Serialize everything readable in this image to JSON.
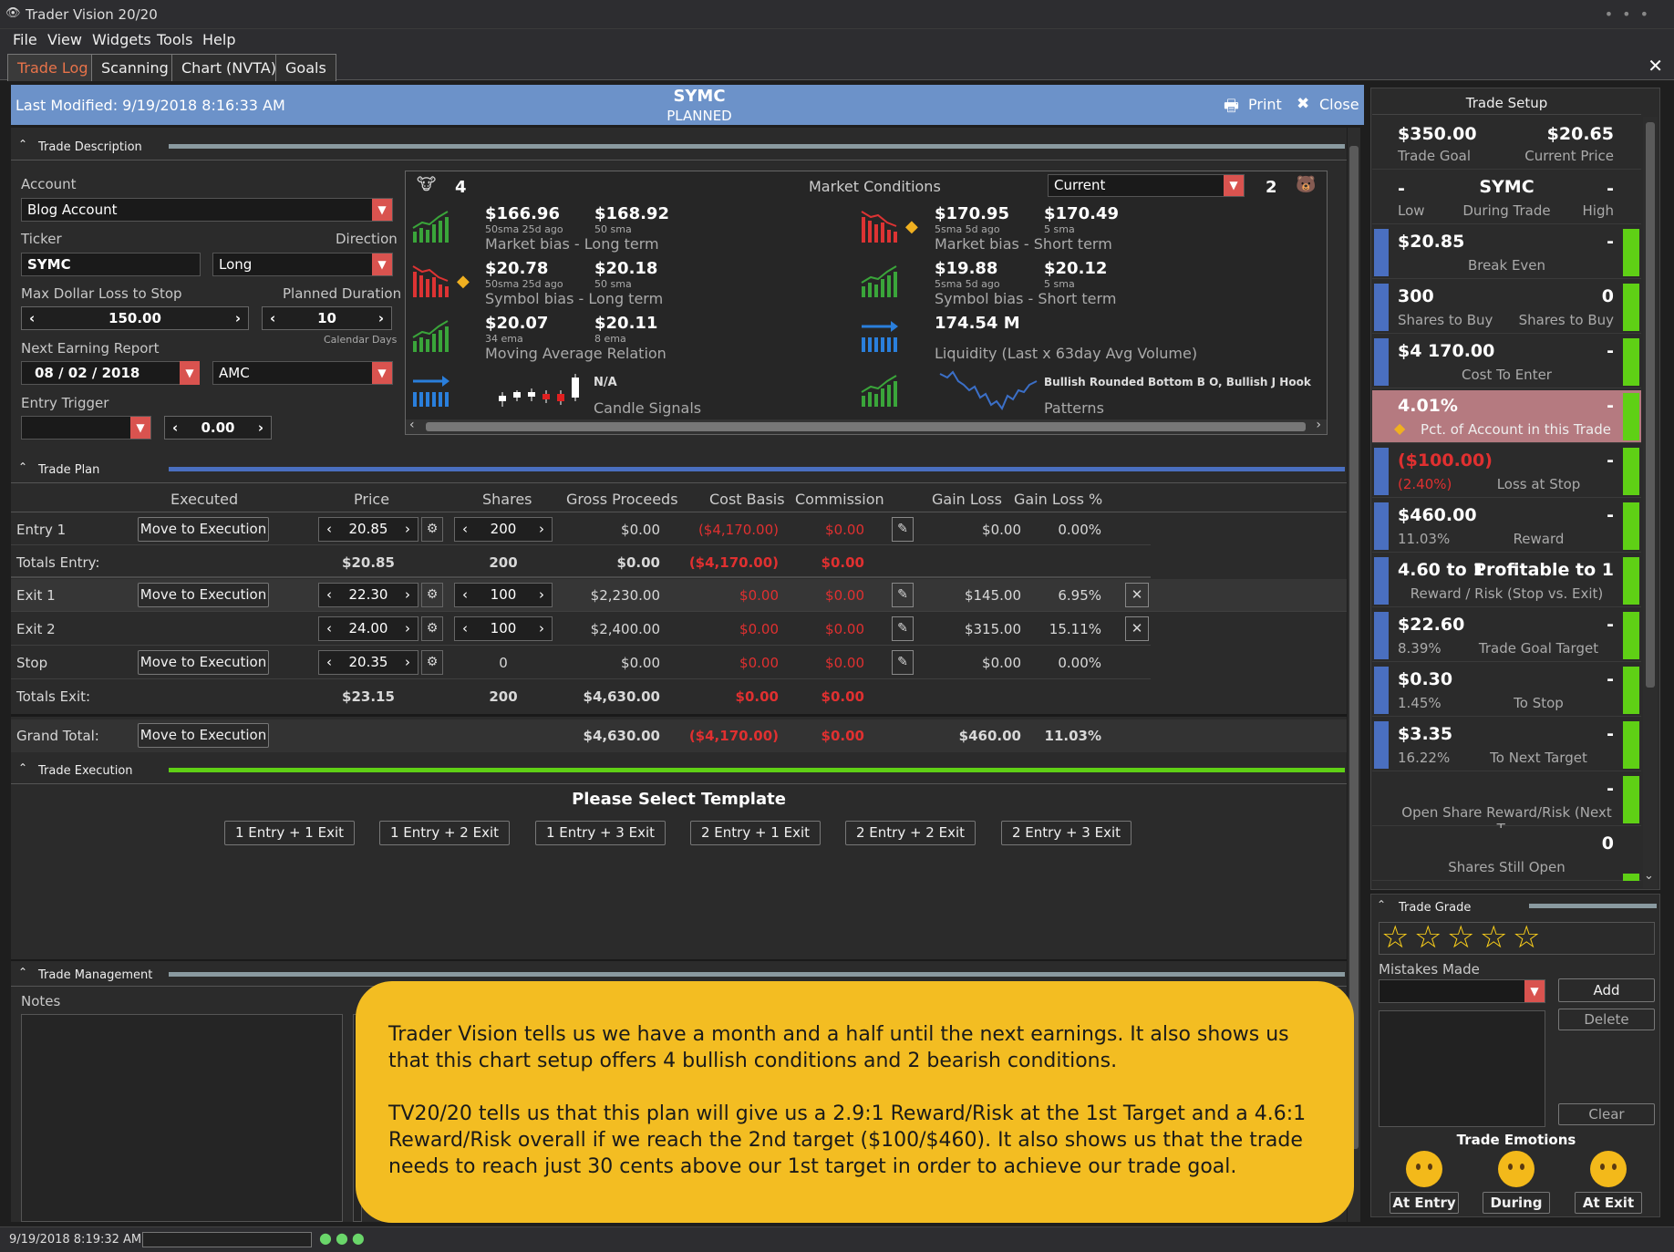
{
  "app": {
    "title": "Trader Vision 20/20"
  },
  "menu": [
    "File",
    "View",
    "Widgets",
    "Tools",
    "Help"
  ],
  "tabs": [
    "Trade Log",
    "Scanning",
    "Chart (NVTA)",
    "Goals"
  ],
  "header": {
    "last_modified": "Last Modified: 9/19/2018 8:16:33 AM",
    "ticker": "SYMC",
    "status": "PLANNED",
    "print": "Print",
    "close": "Close"
  },
  "trade_description": {
    "title": "Trade Description",
    "account_label": "Account",
    "account_value": "Blog Account",
    "ticker_label": "Ticker",
    "ticker_value": "SYMC",
    "direction_label": "Direction",
    "direction_value": "Long",
    "max_loss_label": "Max Dollar Loss to Stop",
    "max_loss_value": "150.00",
    "duration_label": "Planned Duration",
    "duration_value": "10",
    "duration_unit": "Calendar Days",
    "earnings_label": "Next Earning Report",
    "earnings_date": "08 / 02 / 2018",
    "earnings_time": "AMC",
    "entry_trigger_label": "Entry Trigger",
    "entry_trigger_value": "0.00"
  },
  "market_conditions": {
    "title": "Market Conditions",
    "bull_count": "4",
    "bear_count": "2",
    "select_value": "Current",
    "rows": [
      {
        "l1v": "$166.96",
        "l1s": "50sma 25d ago",
        "l2v": "$168.92",
        "l2s": "50 sma",
        "llabel": "Market bias - Long term",
        "r1v": "$170.95",
        "r1s": "5sma 5d ago",
        "r2v": "$170.49",
        "r2s": "5 sma",
        "rlabel": "Market bias - Short term"
      },
      {
        "l1v": "$20.78",
        "l1s": "50sma 25d ago",
        "l2v": "$20.18",
        "l2s": "50 sma",
        "llabel": "Symbol bias - Long term",
        "r1v": "$19.88",
        "r1s": "5sma 5d ago",
        "r2v": "$20.12",
        "r2s": "5 sma",
        "rlabel": "Symbol bias - Short term"
      },
      {
        "l1v": "$20.07",
        "l1s": "34 ema",
        "l2v": "$20.11",
        "l2s": "8 ema",
        "llabel": "Moving Average Relation",
        "r1v": "174.54 M",
        "r1s": "",
        "r2v": "",
        "r2s": "",
        "rlabel": "Liquidity (Last x 63day Avg Volume)"
      },
      {
        "l1v": "N/A",
        "l1s": "",
        "l2v": "",
        "l2s": "",
        "llabel": "Candle Signals",
        "r1v": "Bullish Rounded Bottom B O, Bullish J Hook",
        "r1s": "",
        "r2v": "",
        "r2s": "",
        "rlabel": "Patterns"
      }
    ]
  },
  "trade_plan": {
    "title": "Trade Plan",
    "columns": [
      "Executed",
      "Price",
      "Shares",
      "Gross Proceeds",
      "Cost Basis",
      "Commission",
      "Gain Loss",
      "Gain Loss %"
    ],
    "move_label": "Move to Execution",
    "entry1": {
      "label": "Entry 1",
      "price": "20.85",
      "shares": "200",
      "gross": "$0.00",
      "cost": "($4,170.00)",
      "comm": "$0.00",
      "gain": "$0.00",
      "pct": "0.00%"
    },
    "totals_entry": {
      "label": "Totals Entry:",
      "price": "$20.85",
      "shares": "200",
      "gross": "$0.00",
      "cost": "($4,170.00)",
      "comm": "$0.00"
    },
    "exit1": {
      "label": "Exit 1",
      "price": "22.30",
      "shares": "100",
      "gross": "$2,230.00",
      "cost": "$0.00",
      "comm": "$0.00",
      "gain": "$145.00",
      "pct": "6.95%"
    },
    "exit2": {
      "label": "Exit 2",
      "price": "24.00",
      "shares": "100",
      "gross": "$2,400.00",
      "cost": "$0.00",
      "comm": "$0.00",
      "gain": "$315.00",
      "pct": "15.11%"
    },
    "stop": {
      "label": "Stop",
      "price": "20.35",
      "shares": "0",
      "gross": "$0.00",
      "cost": "$0.00",
      "comm": "$0.00",
      "gain": "$0.00",
      "pct": "0.00%"
    },
    "totals_exit": {
      "label": "Totals Exit:",
      "price": "$23.15",
      "shares": "200",
      "gross": "$4,630.00",
      "cost": "$0.00",
      "comm": "$0.00"
    },
    "grand": {
      "label": "Grand Total:",
      "gross": "$4,630.00",
      "cost": "($4,170.00)",
      "comm": "$0.00",
      "gain": "$460.00",
      "pct": "11.03%"
    }
  },
  "trade_execution": {
    "title": "Trade Execution",
    "prompt": "Please Select Template",
    "templates": [
      "1 Entry + 1 Exit",
      "1 Entry + 2 Exit",
      "1 Entry + 3 Exit",
      "2 Entry + 1 Exit",
      "2 Entry + 2 Exit",
      "2 Entry + 3 Exit"
    ]
  },
  "trade_management": {
    "title": "Trade Management",
    "notes_label": "Notes"
  },
  "callout": {
    "p1": "Trader Vision tells us we have a month and a half until the next earnings.  It also shows us that this chart setup offers 4 bullish conditions and 2 bearish conditions.",
    "p2": "TV20/20 tells us that this plan will give us a 2.9:1 Reward/Risk at the 1st Target and a 4.6:1 Reward/Risk overall if we reach the 2nd target ($100/$460).  It also shows us that the trade needs to reach just  30 cents above our 1st target in order to achieve our trade goal."
  },
  "trade_setup": {
    "title": "Trade Setup",
    "goal": "$350.00",
    "goal_label": "Trade Goal",
    "price": "$20.65",
    "price_label": "Current Price",
    "sym": "SYMC",
    "low": "-",
    "low_label": "Low",
    "during": "During Trade",
    "high": "-",
    "high_label": "High",
    "cards": [
      {
        "v1": "$20.85",
        "v2": "-",
        "c": "Break Even"
      },
      {
        "v1": "300",
        "v2": "0",
        "sl": "Shares to Buy",
        "sr": "Shares to Buy"
      },
      {
        "v1": "$4 170.00",
        "v2": "-",
        "c": "Cost To Enter"
      },
      {
        "v1": "4.01%",
        "v2": "-",
        "c": "Pct. of Account in this Trade"
      },
      {
        "v1": "($100.00)",
        "v2": "-",
        "sl": "(2.40%)",
        "c": "Loss at Stop"
      },
      {
        "v1": "$460.00",
        "v2": "-",
        "sl": "11.03%",
        "c": "Reward"
      },
      {
        "v1": "4.60 to 1",
        "v2": "Profitable to 1",
        "c": "Reward / Risk (Stop vs. Exit)"
      },
      {
        "v1": "$22.60",
        "v2": "-",
        "sl": "8.39%",
        "c": "Trade Goal Target"
      },
      {
        "v1": "$0.30",
        "v2": "-",
        "sl": "1.45%",
        "c": "To Stop"
      },
      {
        "v1": "$3.35",
        "v2": "-",
        "sl": "16.22%",
        "c": "To Next Target"
      },
      {
        "v1": "",
        "v2": "-",
        "c": "Open Share Reward/Risk (Next T..."
      },
      {
        "v1": "",
        "v2": "0",
        "c": "Shares Still Open"
      }
    ]
  },
  "trade_grade": {
    "title": "Trade Grade",
    "mistakes_label": "Mistakes Made",
    "add": "Add",
    "delete": "Delete",
    "clear": "Clear",
    "emotions_label": "Trade Emotions",
    "at_entry": "At Entry",
    "during": "During",
    "at_exit": "At Exit"
  },
  "status": {
    "timestamp": "9/19/2018 8:19:32 AM"
  },
  "colors": {
    "accent": "#e8734a",
    "header": "#6c92c9",
    "bull_green": "#5fd015",
    "loss_red": "#e03030",
    "callout": "#f3bd22"
  }
}
